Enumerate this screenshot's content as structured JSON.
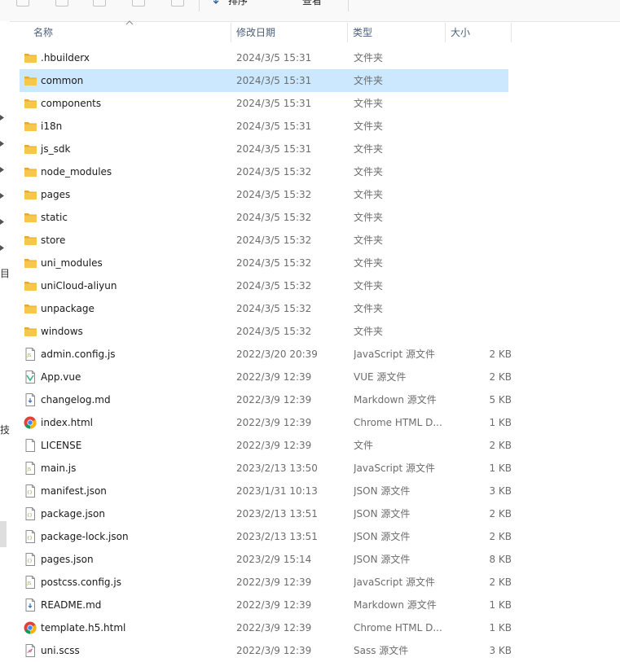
{
  "toolbar": {
    "sort_label": "排序",
    "view_label": "查看"
  },
  "nav": {
    "glyphs": [
      "目",
      "技"
    ]
  },
  "columns": {
    "name": "名称",
    "date": "修改日期",
    "type": "类型",
    "size": "大小"
  },
  "files": [
    {
      "name": ".hbuilderx",
      "date": "2024/3/5 15:31",
      "type": "文件夹",
      "size": "",
      "icon": "folder-icon",
      "selected": false
    },
    {
      "name": "common",
      "date": "2024/3/5 15:31",
      "type": "文件夹",
      "size": "",
      "icon": "folder-icon",
      "selected": true
    },
    {
      "name": "components",
      "date": "2024/3/5 15:31",
      "type": "文件夹",
      "size": "",
      "icon": "folder-icon",
      "selected": false
    },
    {
      "name": "i18n",
      "date": "2024/3/5 15:31",
      "type": "文件夹",
      "size": "",
      "icon": "folder-icon",
      "selected": false
    },
    {
      "name": "js_sdk",
      "date": "2024/3/5 15:31",
      "type": "文件夹",
      "size": "",
      "icon": "folder-icon",
      "selected": false
    },
    {
      "name": "node_modules",
      "date": "2024/3/5 15:32",
      "type": "文件夹",
      "size": "",
      "icon": "folder-icon",
      "selected": false
    },
    {
      "name": "pages",
      "date": "2024/3/5 15:32",
      "type": "文件夹",
      "size": "",
      "icon": "folder-icon",
      "selected": false
    },
    {
      "name": "static",
      "date": "2024/3/5 15:32",
      "type": "文件夹",
      "size": "",
      "icon": "folder-icon",
      "selected": false
    },
    {
      "name": "store",
      "date": "2024/3/5 15:32",
      "type": "文件夹",
      "size": "",
      "icon": "folder-icon",
      "selected": false
    },
    {
      "name": "uni_modules",
      "date": "2024/3/5 15:32",
      "type": "文件夹",
      "size": "",
      "icon": "folder-icon",
      "selected": false
    },
    {
      "name": "uniCloud-aliyun",
      "date": "2024/3/5 15:32",
      "type": "文件夹",
      "size": "",
      "icon": "folder-icon",
      "selected": false
    },
    {
      "name": "unpackage",
      "date": "2024/3/5 15:32",
      "type": "文件夹",
      "size": "",
      "icon": "folder-icon",
      "selected": false
    },
    {
      "name": "windows",
      "date": "2024/3/5 15:32",
      "type": "文件夹",
      "size": "",
      "icon": "folder-icon",
      "selected": false
    },
    {
      "name": "admin.config.js",
      "date": "2022/3/20 20:39",
      "type": "JavaScript 源文件",
      "size": "2 KB",
      "icon": "js-file-icon",
      "selected": false
    },
    {
      "name": "App.vue",
      "date": "2022/3/9 12:39",
      "type": "VUE 源文件",
      "size": "2 KB",
      "icon": "vue-file-icon",
      "selected": false
    },
    {
      "name": "changelog.md",
      "date": "2022/3/9 12:39",
      "type": "Markdown 源文件",
      "size": "5 KB",
      "icon": "markdown-file-icon",
      "selected": false
    },
    {
      "name": "index.html",
      "date": "2022/3/9 12:39",
      "type": "Chrome HTML D...",
      "size": "1 KB",
      "icon": "chrome-icon",
      "selected": false
    },
    {
      "name": "LICENSE",
      "date": "2022/3/9 12:39",
      "type": "文件",
      "size": "2 KB",
      "icon": "blank-file-icon",
      "selected": false
    },
    {
      "name": "main.js",
      "date": "2023/2/13 13:50",
      "type": "JavaScript 源文件",
      "size": "1 KB",
      "icon": "js-file-icon",
      "selected": false
    },
    {
      "name": "manifest.json",
      "date": "2023/1/31 10:13",
      "type": "JSON 源文件",
      "size": "3 KB",
      "icon": "json-file-icon",
      "selected": false
    },
    {
      "name": "package.json",
      "date": "2023/2/13 13:51",
      "type": "JSON 源文件",
      "size": "2 KB",
      "icon": "json-file-icon",
      "selected": false
    },
    {
      "name": "package-lock.json",
      "date": "2023/2/13 13:51",
      "type": "JSON 源文件",
      "size": "2 KB",
      "icon": "json-file-icon",
      "selected": false
    },
    {
      "name": "pages.json",
      "date": "2023/2/9 15:14",
      "type": "JSON 源文件",
      "size": "8 KB",
      "icon": "json-file-icon",
      "selected": false
    },
    {
      "name": "postcss.config.js",
      "date": "2022/3/9 12:39",
      "type": "JavaScript 源文件",
      "size": "2 KB",
      "icon": "js-file-icon",
      "selected": false
    },
    {
      "name": "README.md",
      "date": "2022/3/9 12:39",
      "type": "Markdown 源文件",
      "size": "1 KB",
      "icon": "markdown-file-icon",
      "selected": false
    },
    {
      "name": "template.h5.html",
      "date": "2022/3/9 12:39",
      "type": "Chrome HTML D...",
      "size": "1 KB",
      "icon": "chrome-icon",
      "selected": false
    },
    {
      "name": "uni.scss",
      "date": "2022/3/9 12:39",
      "type": "Sass 源文件",
      "size": "3 KB",
      "icon": "sass-file-icon",
      "selected": false
    }
  ],
  "colors": {
    "folder": "#f5c84c",
    "folder_back": "#e8aa2a",
    "selected_row": "#cce8ff",
    "header_text": "#4c607a",
    "meta_text": "#6d6d6d"
  }
}
